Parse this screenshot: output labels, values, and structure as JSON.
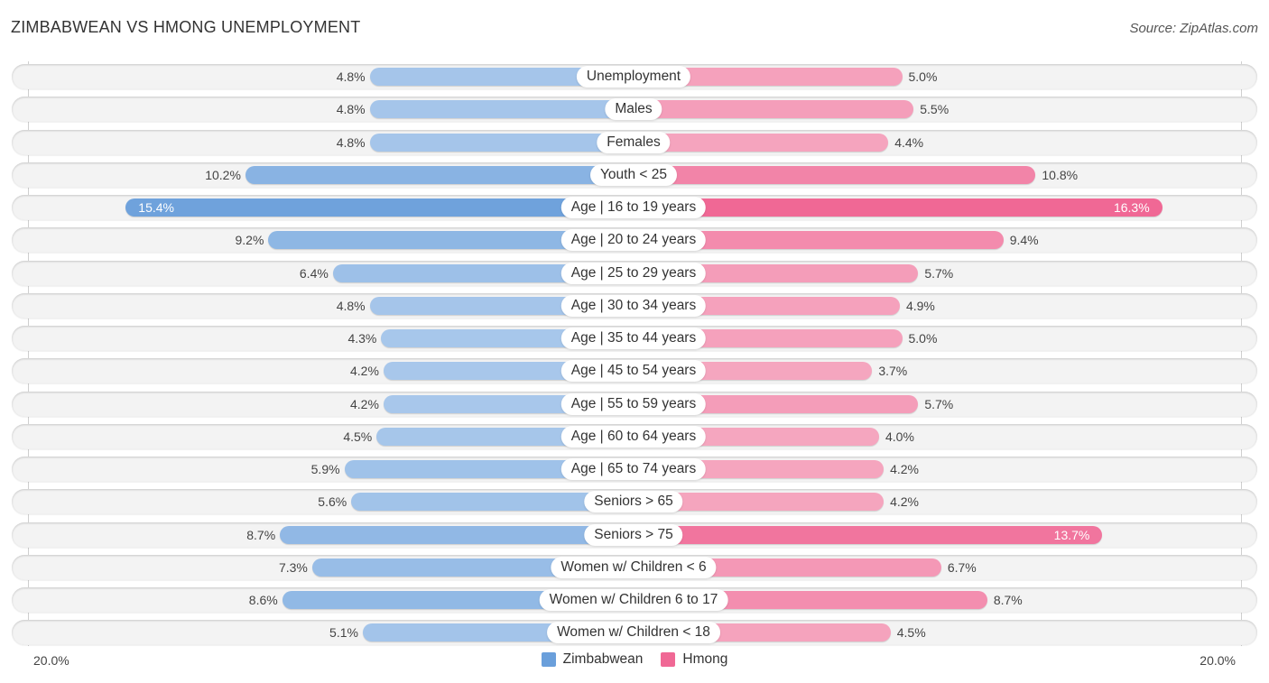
{
  "title": "ZIMBABWEAN VS HMONG UNEMPLOYMENT",
  "source": "Source: ZipAtlas.com",
  "colors": {
    "zimbabwean_dark": "#6a9fdb",
    "zimbabwean_light": "#a9c8eb",
    "hmong_dark": "#f06895",
    "hmong_light": "#f5a6bf"
  },
  "legend": [
    {
      "label": "Zimbabwean",
      "color": "#6a9fdb"
    },
    {
      "label": "Hmong",
      "color": "#f06895"
    }
  ],
  "axis": {
    "left_label": "20.0%",
    "right_label": "20.0%"
  },
  "chart_data": {
    "type": "bar",
    "orientation": "horizontal-diverging",
    "title": "ZIMBABWEAN VS HMONG UNEMPLOYMENT",
    "xlabel": "",
    "ylabel": "",
    "xlim": [
      0,
      20
    ],
    "unit": "%",
    "legend_position": "bottom-center",
    "categories": [
      "Unemployment",
      "Males",
      "Females",
      "Youth < 25",
      "Age | 16 to 19 years",
      "Age | 20 to 24 years",
      "Age | 25 to 29 years",
      "Age | 30 to 34 years",
      "Age | 35 to 44 years",
      "Age | 45 to 54 years",
      "Age | 55 to 59 years",
      "Age | 60 to 64 years",
      "Age | 65 to 74 years",
      "Seniors > 65",
      "Seniors > 75",
      "Women w/ Children < 6",
      "Women w/ Children 6 to 17",
      "Women w/ Children < 18"
    ],
    "series": [
      {
        "name": "Zimbabwean",
        "side": "left",
        "values": [
          4.8,
          4.8,
          4.8,
          10.2,
          15.4,
          9.2,
          6.4,
          4.8,
          4.3,
          4.2,
          4.2,
          4.5,
          5.9,
          5.6,
          8.7,
          7.3,
          8.6,
          5.1
        ],
        "labels": [
          "4.8%",
          "4.8%",
          "4.8%",
          "10.2%",
          "15.4%",
          "9.2%",
          "6.4%",
          "4.8%",
          "4.3%",
          "4.2%",
          "4.2%",
          "4.5%",
          "5.9%",
          "5.6%",
          "8.7%",
          "7.3%",
          "8.6%",
          "5.1%"
        ]
      },
      {
        "name": "Hmong",
        "side": "right",
        "values": [
          5.0,
          5.5,
          4.4,
          10.8,
          16.3,
          9.4,
          5.7,
          4.9,
          5.0,
          3.7,
          5.7,
          4.0,
          4.2,
          4.2,
          13.7,
          6.7,
          8.7,
          4.5
        ],
        "labels": [
          "5.0%",
          "5.5%",
          "4.4%",
          "10.8%",
          "16.3%",
          "9.4%",
          "5.7%",
          "4.9%",
          "5.0%",
          "3.7%",
          "5.7%",
          "4.0%",
          "4.2%",
          "4.2%",
          "13.7%",
          "6.7%",
          "8.7%",
          "4.5%"
        ]
      }
    ]
  }
}
